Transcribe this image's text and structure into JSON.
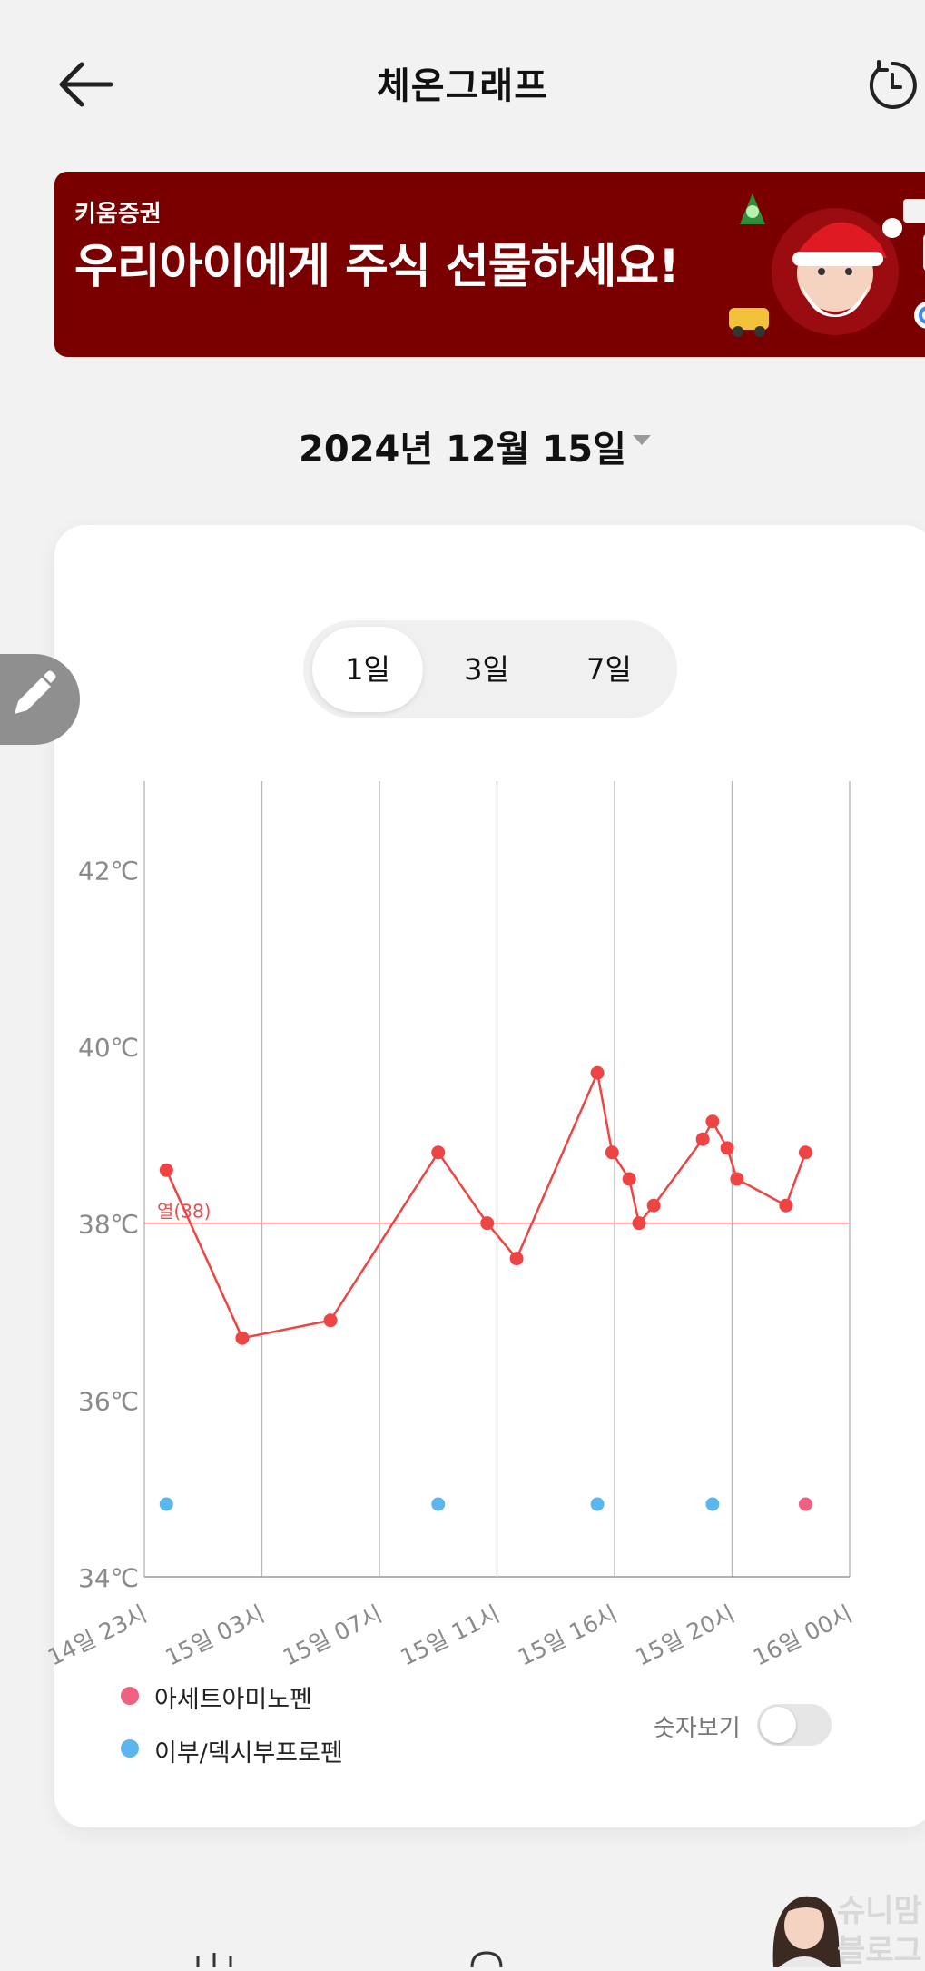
{
  "header": {
    "title": "체온그래프"
  },
  "banner": {
    "brand": "키움증권",
    "text": "우리아이에게 주식 선물하세요!"
  },
  "date": {
    "label": "2024년 12월 15일"
  },
  "range_tabs": [
    {
      "label": "1일",
      "selected": true
    },
    {
      "label": "3일",
      "selected": false
    },
    {
      "label": "7일",
      "selected": false
    }
  ],
  "chart_data": {
    "type": "line",
    "y_ticks": [
      "42℃",
      "40℃",
      "38℃",
      "36℃",
      "34℃"
    ],
    "ylim": [
      34,
      43
    ],
    "x_ticks": [
      "14일 23시",
      "15일 03시",
      "15일 07시",
      "15일 11시",
      "15일 16시",
      "15일 20시",
      "16일 00시"
    ],
    "threshold": {
      "value": 38,
      "label": "열(38)"
    },
    "series": [
      {
        "color": "#ef4444",
        "points": [
          {
            "x": "14일 23:45",
            "y": 38.6
          },
          {
            "x": "15일 02:20",
            "y": 36.7
          },
          {
            "x": "15일 05:20",
            "y": 36.9
          },
          {
            "x": "15일 09:00",
            "y": 38.8
          },
          {
            "x": "15일 10:40",
            "y": 38.0
          },
          {
            "x": "15일 11:40",
            "y": 37.6
          },
          {
            "x": "15일 14:25",
            "y": 39.7
          },
          {
            "x": "15일 14:55",
            "y": 38.8
          },
          {
            "x": "15일 15:30",
            "y": 38.5
          },
          {
            "x": "15일 15:50",
            "y": 38.0
          },
          {
            "x": "15일 16:20",
            "y": 38.2
          },
          {
            "x": "15일 18:00",
            "y": 38.95
          },
          {
            "x": "15일 18:20",
            "y": 39.15
          },
          {
            "x": "15일 18:50",
            "y": 38.85
          },
          {
            "x": "15일 19:10",
            "y": 38.5
          },
          {
            "x": "15일 20:50",
            "y": 38.2
          },
          {
            "x": "15일 21:30",
            "y": 38.8
          }
        ]
      }
    ],
    "medication_markers": [
      {
        "x": "14일 23:45",
        "medicine": "이부/덱시부프로펜"
      },
      {
        "x": "15일 09:00",
        "medicine": "이부/덱시부프로펜"
      },
      {
        "x": "15일 14:25",
        "medicine": "이부/덱시부프로펜"
      },
      {
        "x": "15일 18:20",
        "medicine": "이부/덱시부프로펜"
      },
      {
        "x": "15일 21:30",
        "medicine": "아세트아미노펜"
      }
    ]
  },
  "legend": [
    {
      "label": "아세트아미노펜",
      "color": "#f06080"
    },
    {
      "label": "이부/덱시부프로펜",
      "color": "#5ab6ec"
    }
  ],
  "number_toggle": {
    "label": "숫자보기",
    "on": false
  },
  "watermark": {
    "line1": "슈니맘",
    "line2": "블로그"
  }
}
